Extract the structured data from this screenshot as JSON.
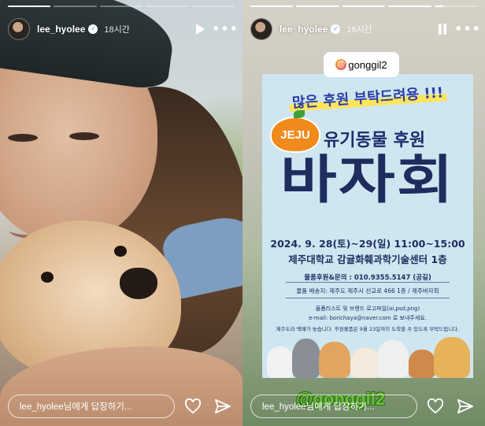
{
  "stories": [
    {
      "id": "left",
      "progress": [
        1.0,
        0.0,
        0.0,
        0.0,
        0.0
      ],
      "header": {
        "username": "lee_hyolee",
        "verified_badge": "✓",
        "time": "18시간",
        "controls": [
          "play-icon",
          "more-icon"
        ],
        "more_label": "•••"
      },
      "reply_placeholder": "lee_hyolee님에게 답장하기..."
    },
    {
      "id": "right",
      "progress": [
        1.0,
        1.0,
        1.0,
        1.0,
        0.2
      ],
      "header": {
        "username": "lee_hyolee",
        "verified_badge": "✓",
        "time": "16시간",
        "controls": [
          "pause-icon",
          "more-icon"
        ],
        "more_label": "•••"
      },
      "mention_tag": "gonggil2",
      "mention_symbol": "@",
      "poster": {
        "headline": "많은 후원 부탁드려용 !!!",
        "jeju_badge": "JEJU",
        "subtitle": "유기동물 후원",
        "title": "바자회",
        "date": "2024. 9. 28(토)~29(일) 11:00~15:00",
        "venue": "제주대학교 감귤화훼과학기술센터 1층",
        "contact": "물품후원&문의 : 010.9355.5147 (공길)",
        "address": "물품 배송지: 제주도 제주시 선교로 466 1층 / 제주바자회",
        "list_note": "물품리스트 및 브랜드 로고파일(ai,psd,png)",
        "email": "e-mail: borichaya@naver.com 로 보내주세요.",
        "deadline": "제주도라 택배가 늦습니다. 후원물품은 9월 23일까지 도착할 수 있도록 부탁드립니다."
      },
      "watermark": "@gonggil2",
      "reply_placeholder": "lee_hyolee님에게 답장하기..."
    }
  ],
  "colors": {
    "poster_bg": "#cfe6f1",
    "poster_text": "#1e2c5e",
    "jeju_orange": "#f08a1c",
    "watermark_green": "#6ac23a"
  }
}
